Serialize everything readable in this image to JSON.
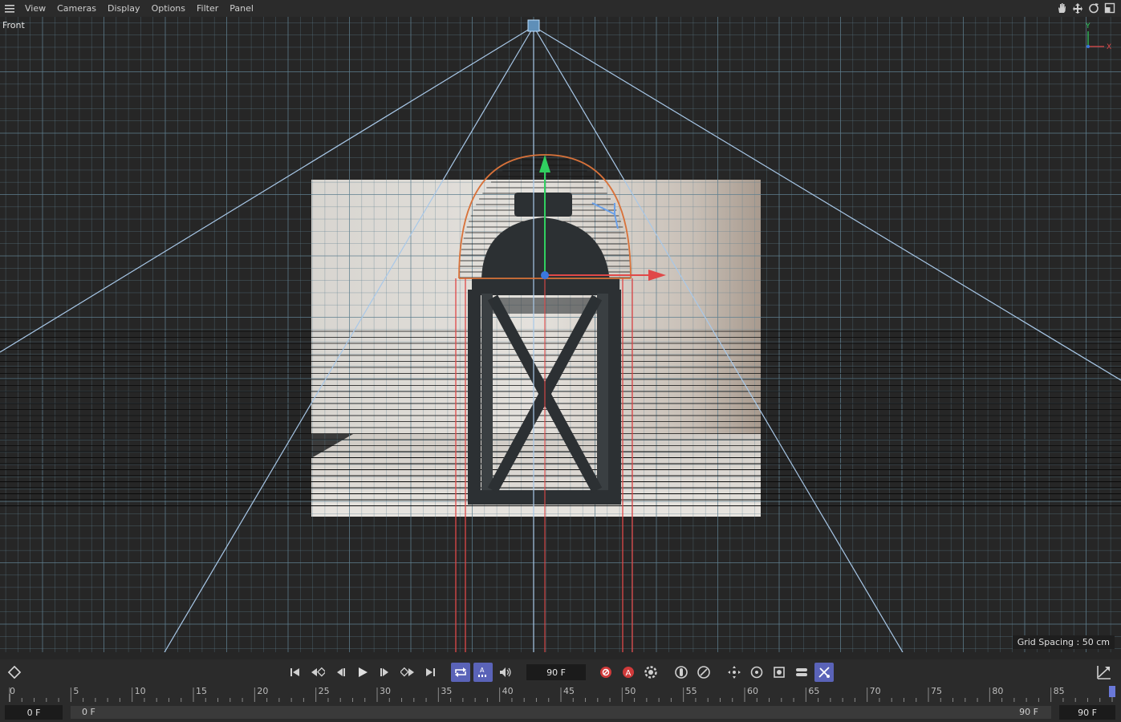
{
  "menu": {
    "items": [
      "View",
      "Cameras",
      "Display",
      "Options",
      "Filter",
      "Panel"
    ],
    "right_icons": [
      "hand-icon",
      "move-view-icon",
      "rotate-view-icon",
      "maximize-icon"
    ]
  },
  "viewport": {
    "label": "Front",
    "grid_spacing": "Grid Spacing : 50 cm",
    "axis_labels": {
      "y": "Y",
      "x": "X"
    }
  },
  "toolbar": {
    "current_frame": "90 F",
    "buttons": [
      "keyframe-icon",
      "go-to-start-icon",
      "previous-key-icon",
      "previous-frame-icon",
      "play-icon",
      "next-frame-icon",
      "next-key-icon",
      "go-to-end-icon",
      "loop-icon",
      "autokey-icon",
      "sound-icon",
      "record-icon",
      "autokey-record-icon",
      "key-settings-icon",
      "motion-icon",
      "scale-key-icon",
      "move-key-icon",
      "rotate-key-icon",
      "param-icon",
      "pla-icon",
      "point-level-icon",
      "timeline-icon"
    ]
  },
  "ruler": {
    "ticks": [
      "0",
      "5",
      "10",
      "15",
      "20",
      "25",
      "30",
      "35",
      "40",
      "45",
      "50",
      "55",
      "60",
      "65",
      "70",
      "75",
      "80",
      "85"
    ]
  },
  "range": {
    "start_field": "0 F",
    "range_start": "0 F",
    "range_end": "90 F",
    "end_field": "90 F"
  },
  "colors": {
    "grid": "#5f7f8f",
    "camera_lines": "#a8c8e8",
    "object_outline": "#e06040",
    "selection_red": "#e04848",
    "active_button": "#5a63b8"
  }
}
